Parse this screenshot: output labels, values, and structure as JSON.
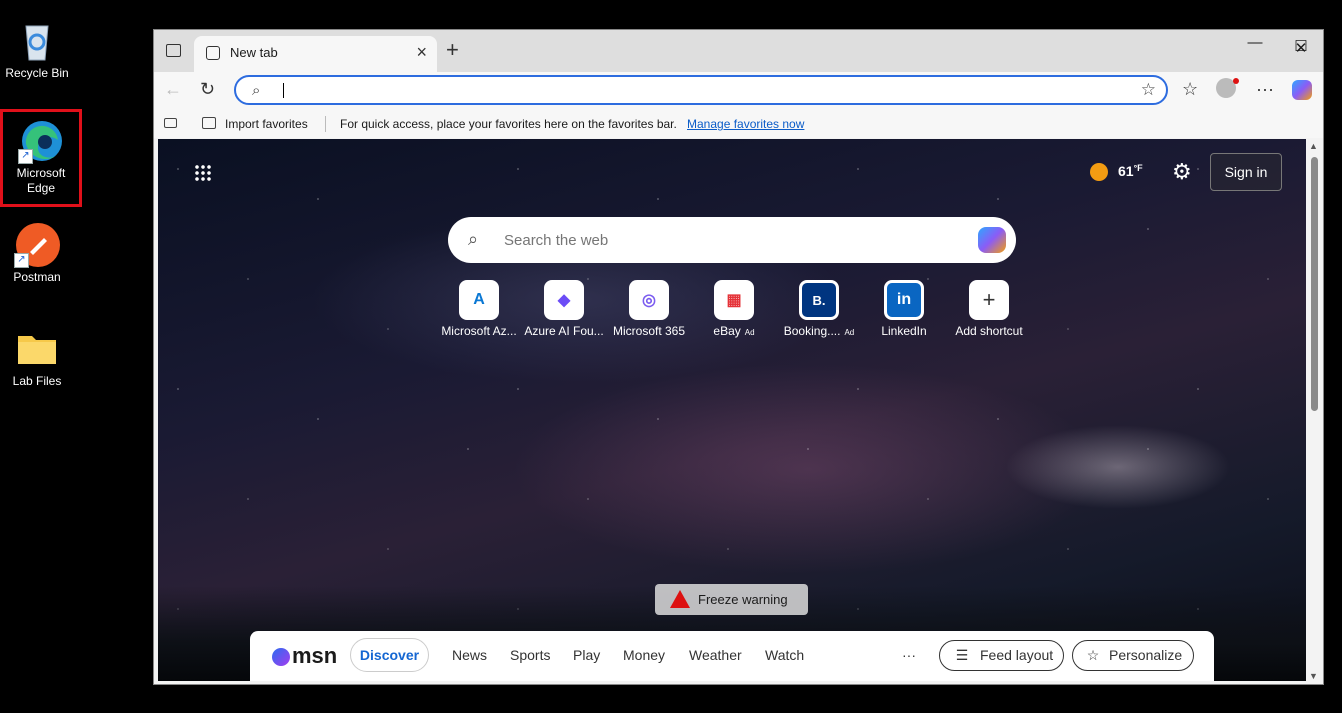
{
  "desktop": {
    "icons": [
      {
        "label": "Recycle Bin"
      },
      {
        "label": "Microsoft Edge"
      },
      {
        "label": "Postman"
      },
      {
        "label": "Lab Files"
      }
    ]
  },
  "browser": {
    "tab": {
      "title": "New tab"
    },
    "window_controls": {
      "minimize": "—",
      "maximize": "☐",
      "close": "✕"
    },
    "address": {
      "value": ""
    },
    "favorites_bar": {
      "import_label": "Import favorites",
      "hint": "For quick access, place your favorites here on the favorites bar.",
      "manage_link": "Manage favorites now"
    }
  },
  "newtab": {
    "weather": {
      "temp": "61",
      "unit": "°F"
    },
    "sign_in": "Sign in",
    "search_placeholder": "Search the web",
    "shortcuts": [
      {
        "label": "Microsoft Az...",
        "glyph": "A",
        "color": "#0a78d4",
        "ad": ""
      },
      {
        "label": "Azure AI Fou...",
        "glyph": "◆",
        "color": "#6b4cf6",
        "ad": ""
      },
      {
        "label": "Microsoft 365",
        "glyph": "◎",
        "color": "#7b5cf0",
        "ad": ""
      },
      {
        "label": "eBay",
        "glyph": "▦",
        "color": "#e53238",
        "ad": "Ad"
      },
      {
        "label": "Booking....",
        "glyph": "B.",
        "color": "#003580",
        "ad": "Ad"
      },
      {
        "label": "LinkedIn",
        "glyph": "in",
        "color": "#0a66c2",
        "ad": ""
      },
      {
        "label": "Add shortcut",
        "glyph": "+",
        "color": "#333333",
        "ad": ""
      }
    ],
    "alert": "Freeze warning",
    "msn": {
      "logo": "msn",
      "nav": [
        "Discover",
        "News",
        "Sports",
        "Play",
        "Money",
        "Weather",
        "Watch"
      ],
      "more": "···",
      "feed_layout": "Feed layout",
      "personalize": "Personalize"
    }
  }
}
